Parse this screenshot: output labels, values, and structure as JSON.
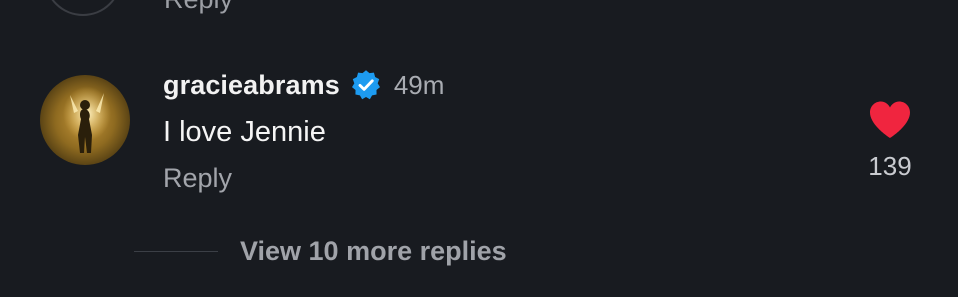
{
  "previous_comment": {
    "reply_label": "Reply"
  },
  "comment": {
    "username": "gracieabrams",
    "verified": true,
    "timestamp": "49m",
    "text": "I love Jennie",
    "reply_label": "Reply",
    "like_count": "139",
    "liked": true
  },
  "replies": {
    "view_more_label": "View 10 more replies"
  },
  "colors": {
    "background": "#181b20",
    "heart": "#f0253f",
    "verified": "#1d9bf0",
    "muted_text": "#a2a5ab"
  },
  "icons": {
    "verified": "verified-badge-icon",
    "like": "heart-icon"
  }
}
